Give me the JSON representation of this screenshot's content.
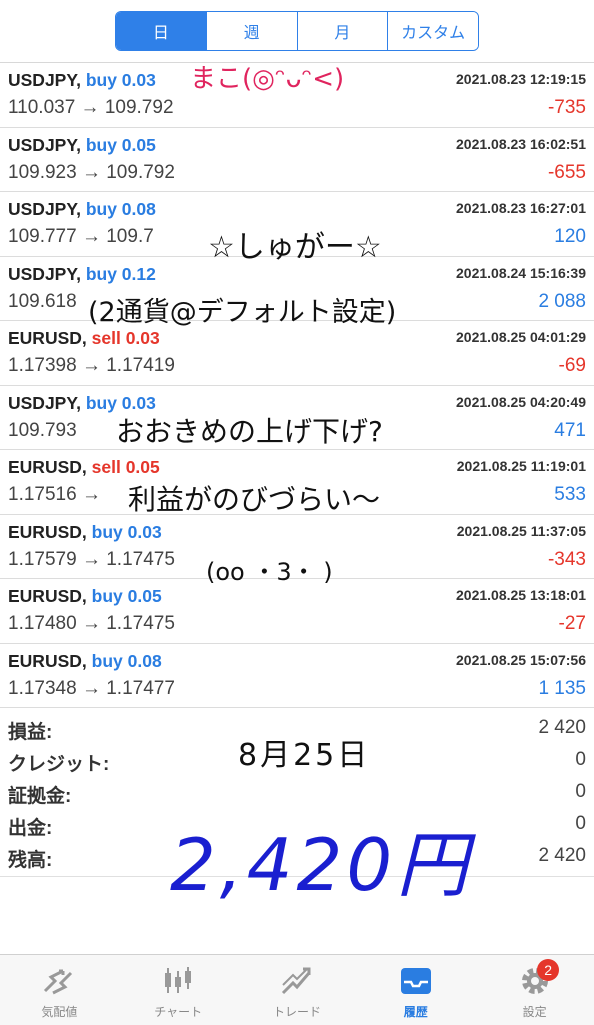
{
  "period_tabs": [
    {
      "label": "日",
      "active": true
    },
    {
      "label": "週",
      "active": false
    },
    {
      "label": "月",
      "active": false
    },
    {
      "label": "カスタム",
      "active": false
    }
  ],
  "deals": [
    {
      "symbol": "USDJPY,",
      "side": "buy 0.03",
      "side_type": "buy",
      "date": "2021.08.23 12:19:15",
      "prices": "110.037 → 109.792",
      "profit": "-735",
      "profit_sign": "neg"
    },
    {
      "symbol": "USDJPY,",
      "side": "buy 0.05",
      "side_type": "buy",
      "date": "2021.08.23 16:02:51",
      "prices": "109.923 → 109.792",
      "profit": "-655",
      "profit_sign": "neg"
    },
    {
      "symbol": "USDJPY,",
      "side": "buy 0.08",
      "side_type": "buy",
      "date": "2021.08.23 16:27:01",
      "prices": "109.777 → 109.7",
      "profit": "120",
      "profit_sign": "pos"
    },
    {
      "symbol": "USDJPY,",
      "side": "buy 0.12",
      "side_type": "buy",
      "date": "2021.08.24 15:16:39",
      "prices": "109.618",
      "profit": "2 088",
      "profit_sign": "pos"
    },
    {
      "symbol": "EURUSD,",
      "side": "sell 0.03",
      "side_type": "sell",
      "date": "2021.08.25 04:01:29",
      "prices": "1.17398 → 1.17419",
      "profit": "-69",
      "profit_sign": "neg"
    },
    {
      "symbol": "USDJPY,",
      "side": "buy 0.03",
      "side_type": "buy",
      "date": "2021.08.25 04:20:49",
      "prices": "109.793",
      "profit": "471",
      "profit_sign": "pos"
    },
    {
      "symbol": "EURUSD,",
      "side": "sell 0.05",
      "side_type": "sell",
      "date": "2021.08.25 11:19:01",
      "prices": "1.17516 →",
      "profit": "533",
      "profit_sign": "pos"
    },
    {
      "symbol": "EURUSD,",
      "side": "buy 0.03",
      "side_type": "buy",
      "date": "2021.08.25 11:37:05",
      "prices": "1.17579 → 1.17475",
      "profit": "-343",
      "profit_sign": "neg"
    },
    {
      "symbol": "EURUSD,",
      "side": "buy 0.05",
      "side_type": "buy",
      "date": "2021.08.25 13:18:01",
      "prices": "1.17480 → 1.17475",
      "profit": "-27",
      "profit_sign": "neg"
    },
    {
      "symbol": "EURUSD,",
      "side": "buy 0.08",
      "side_type": "buy",
      "date": "2021.08.25 15:07:56",
      "prices": "1.17348 → 1.17477",
      "profit": "1 135",
      "profit_sign": "pos"
    }
  ],
  "summary": [
    {
      "label": "損益:",
      "value": "2 420"
    },
    {
      "label": "クレジット:",
      "value": "0"
    },
    {
      "label": "証拠金:",
      "value": "0"
    },
    {
      "label": "出金:",
      "value": "0"
    },
    {
      "label": "残高:",
      "value": "2 420"
    }
  ],
  "handwriting": {
    "name": "まこ(◎ᵔᴗᵔ<)",
    "line1": "☆しゅがー☆",
    "line2": "(2通貨@デフォルト設定)",
    "line3": "おおきめの上げ下げ?",
    "line4": "利益がのびづらい〜",
    "line5": "(oo ・3・ )",
    "date": "8月25日",
    "amount": "2,420円"
  },
  "tabbar": [
    {
      "label": "気配値",
      "icon": "quotes-icon",
      "active": false
    },
    {
      "label": "チャート",
      "icon": "candlestick-chart-icon",
      "active": false
    },
    {
      "label": "トレード",
      "icon": "trade-chart-icon",
      "active": false
    },
    {
      "label": "履歴",
      "icon": "history-inbox-icon",
      "active": true
    },
    {
      "label": "設定",
      "icon": "gear-icon",
      "active": false,
      "badge": "2"
    }
  ],
  "colors": {
    "accent": "#2a7de1",
    "loss": "#e5362b",
    "handwriting_blue": "#1a1fd0",
    "handwriting_red": "#e0245e"
  }
}
